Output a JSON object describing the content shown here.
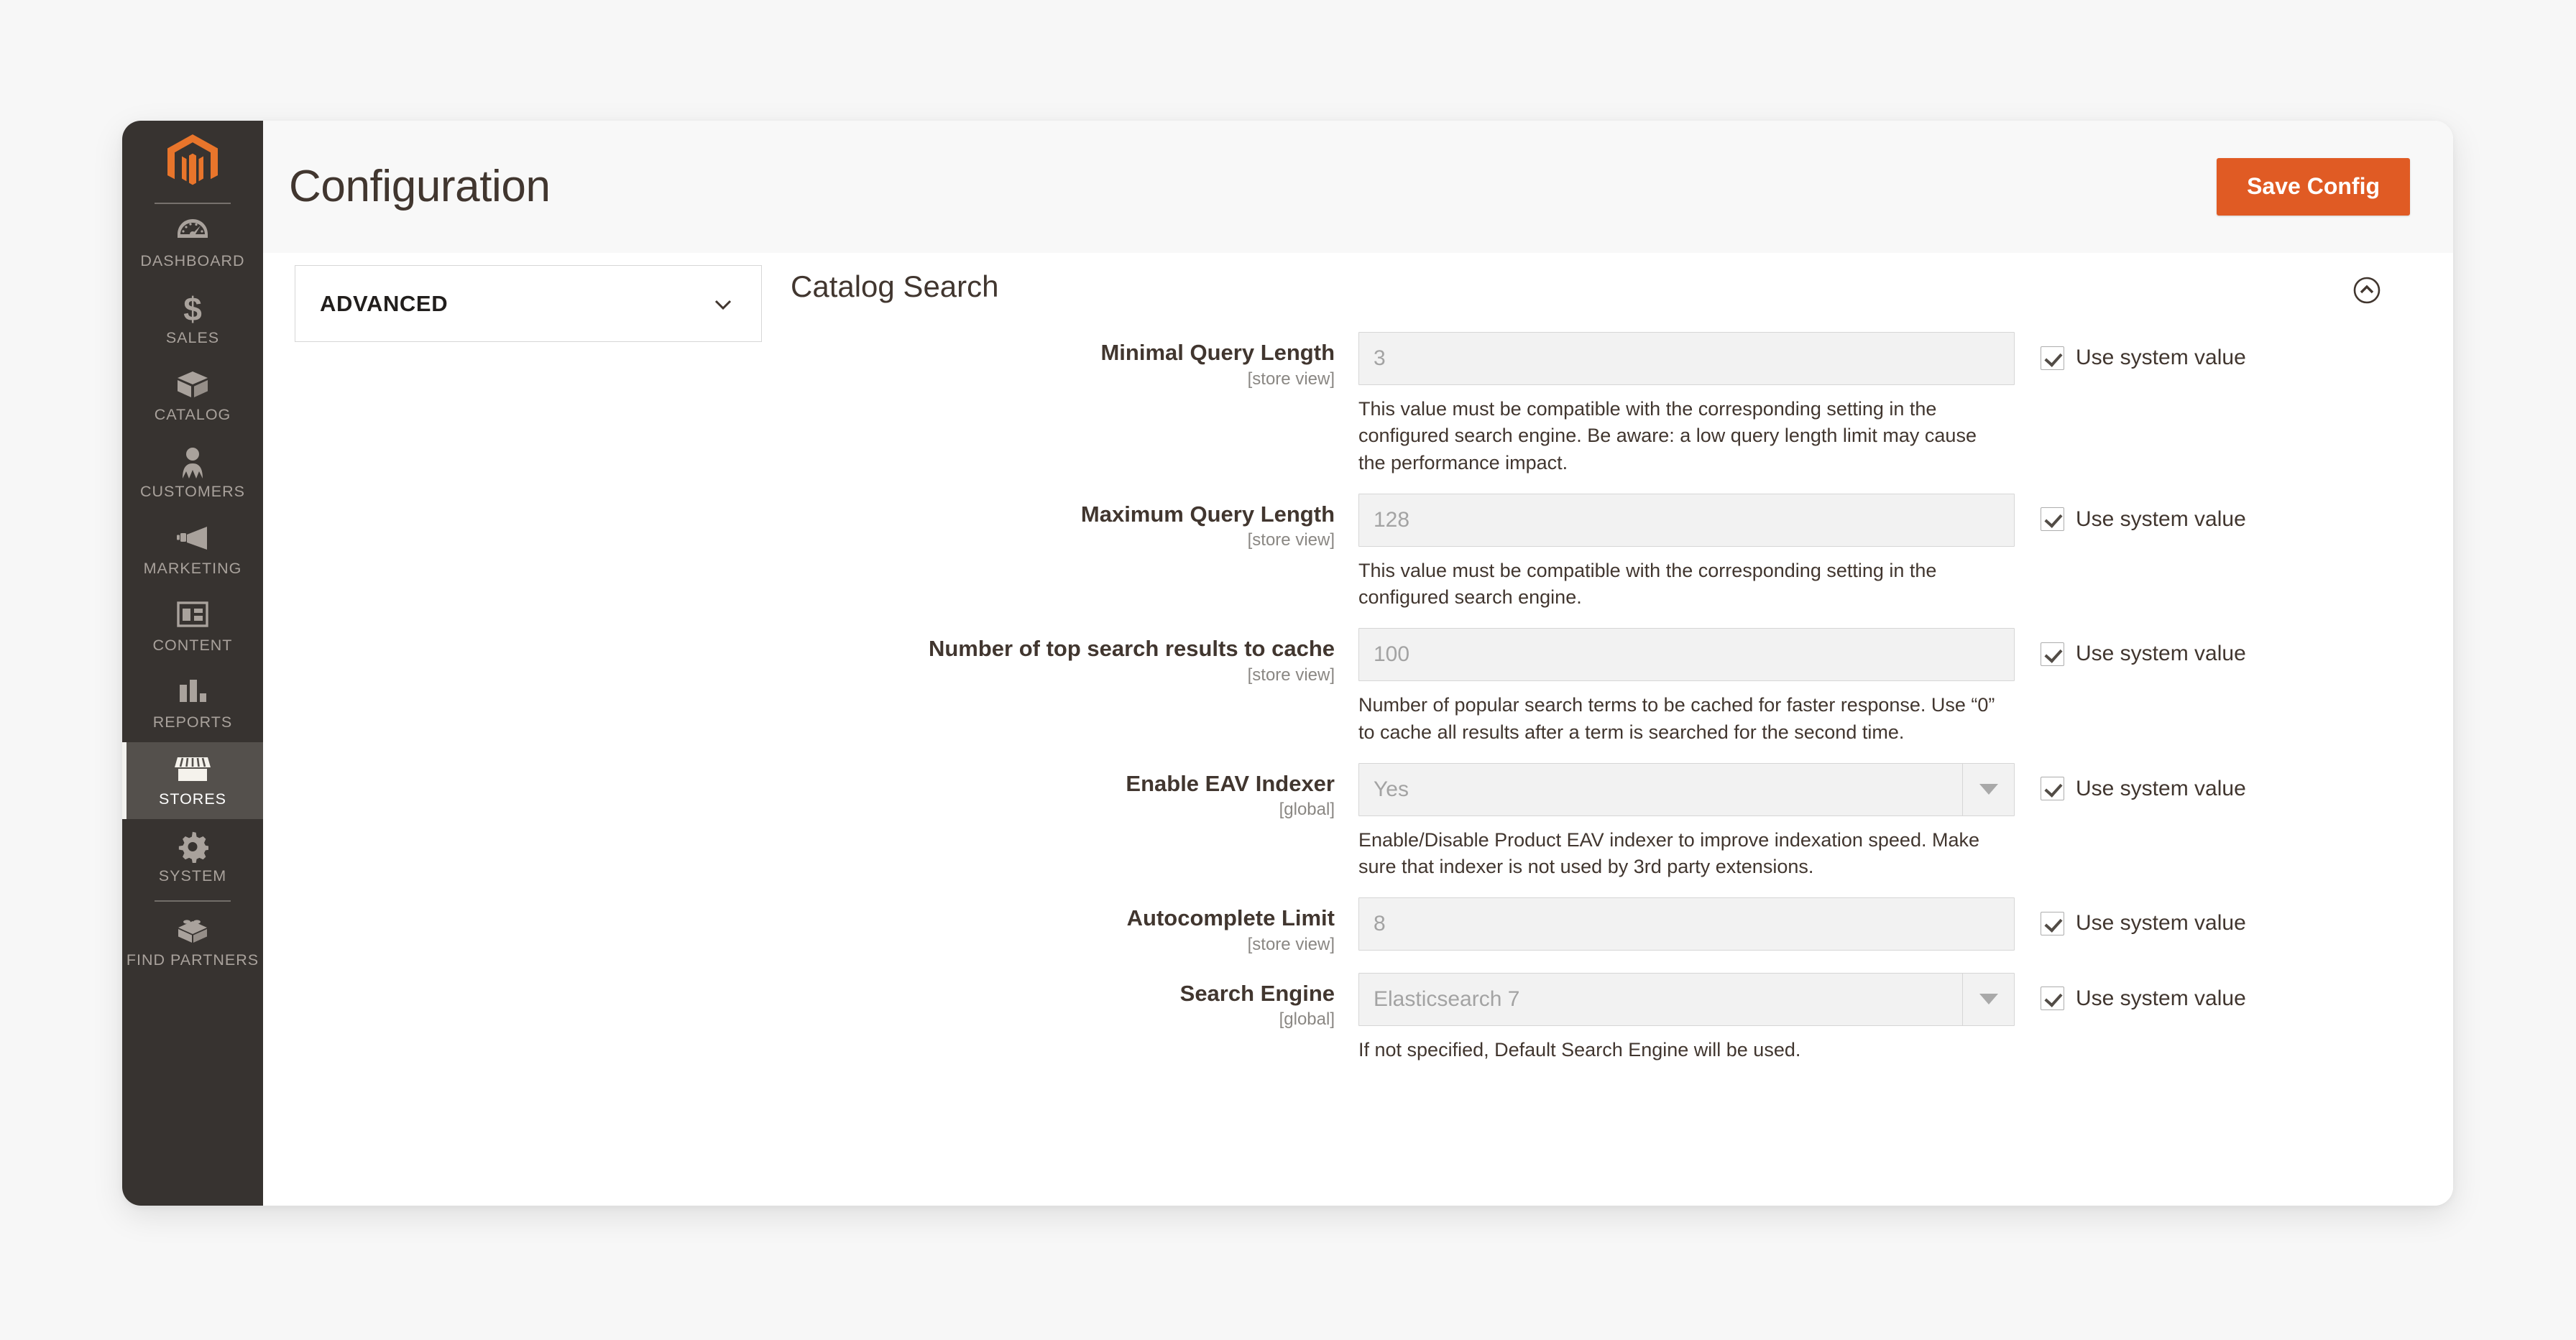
{
  "header": {
    "title": "Configuration",
    "save_label": "Save Config"
  },
  "sidebar": {
    "logo_name": "magento-logo",
    "items": [
      {
        "label": "DASHBOARD",
        "icon": "dashboard-icon",
        "active": false
      },
      {
        "label": "SALES",
        "icon": "dollar-icon",
        "active": false
      },
      {
        "label": "CATALOG",
        "icon": "box-icon",
        "active": false
      },
      {
        "label": "CUSTOMERS",
        "icon": "person-icon",
        "active": false
      },
      {
        "label": "MARKETING",
        "icon": "megaphone-icon",
        "active": false
      },
      {
        "label": "CONTENT",
        "icon": "layout-icon",
        "active": false
      },
      {
        "label": "REPORTS",
        "icon": "bar-chart-icon",
        "active": false
      },
      {
        "label": "STORES",
        "icon": "storefront-icon",
        "active": true
      },
      {
        "label": "SYSTEM",
        "icon": "gear-icon",
        "active": false
      },
      {
        "label": "FIND PARTNERS",
        "icon": "brick-icon",
        "active": false
      }
    ]
  },
  "config_nav": {
    "selected_section": "ADVANCED",
    "chevron": "chevron-down-icon"
  },
  "section": {
    "title": "Catalog Search",
    "collapse_icon": "chevron-up-circle-icon"
  },
  "checkbox_label": "Use system value",
  "fields": [
    {
      "label": "Minimal Query Length",
      "scope": "[store view]",
      "type": "text",
      "value": "3",
      "note": "This value must be compatible with the corresponding setting in the configured search engine. Be aware: a low query length limit may cause the performance impact.",
      "use_system_value": true
    },
    {
      "label": "Maximum Query Length",
      "scope": "[store view]",
      "type": "text",
      "value": "128",
      "note": "This value must be compatible with the corresponding setting in the configured search engine.",
      "use_system_value": true
    },
    {
      "label": "Number of top search results to cache",
      "scope": "[store view]",
      "type": "text",
      "value": "100",
      "note": "Number of popular search terms to be cached for faster response. Use “0” to cache all results after a term is searched for the second time.",
      "use_system_value": true
    },
    {
      "label": "Enable EAV Indexer",
      "scope": "[global]",
      "type": "select",
      "value": "Yes",
      "note": "Enable/Disable Product EAV indexer to improve indexation speed. Make sure that indexer is not used by 3rd party extensions.",
      "use_system_value": true
    },
    {
      "label": "Autocomplete Limit",
      "scope": "[store view]",
      "type": "text",
      "value": "8",
      "note": "",
      "use_system_value": true
    },
    {
      "label": "Search Engine",
      "scope": "[global]",
      "type": "select",
      "value": "Elasticsearch 7",
      "note": "If not specified, Default Search Engine will be used.",
      "use_system_value": true
    }
  ]
}
